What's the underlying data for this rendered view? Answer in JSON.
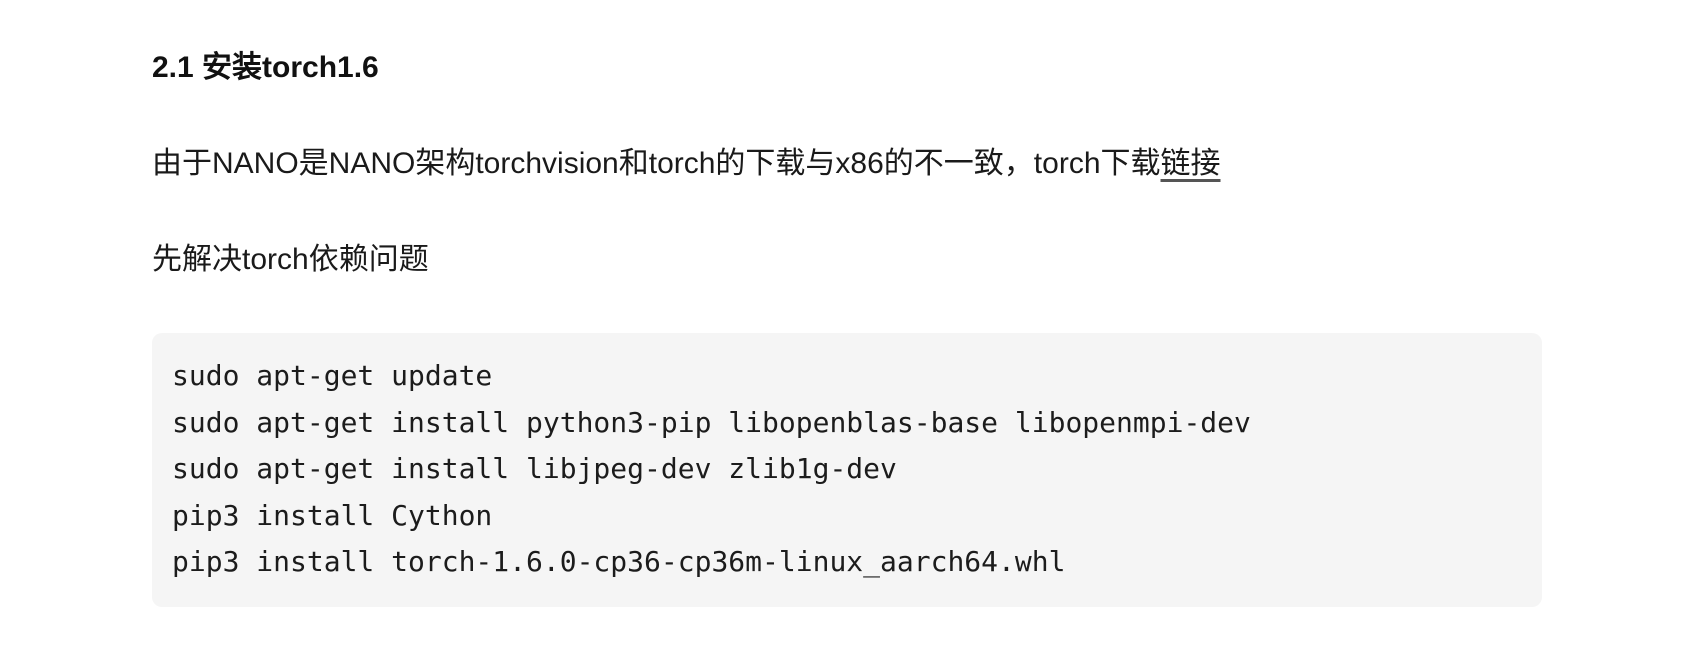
{
  "heading": {
    "text": "2.1 安装torch1.6"
  },
  "paragraphs": {
    "intro_text": "由于NANO是NANO架构torchvision和torch的下载与x86的不一致，torch下载",
    "intro_link": "链接",
    "dependencies_text": "先解决torch依赖问题"
  },
  "code_block": {
    "lines": [
      "sudo apt-get update",
      "sudo apt-get install python3-pip libopenblas-base libopenmpi-dev",
      "sudo apt-get install libjpeg-dev zlib1g-dev",
      "pip3 install Cython",
      "pip3 install torch-1.6.0-cp36-cp36m-linux_aarch64.whl"
    ]
  }
}
